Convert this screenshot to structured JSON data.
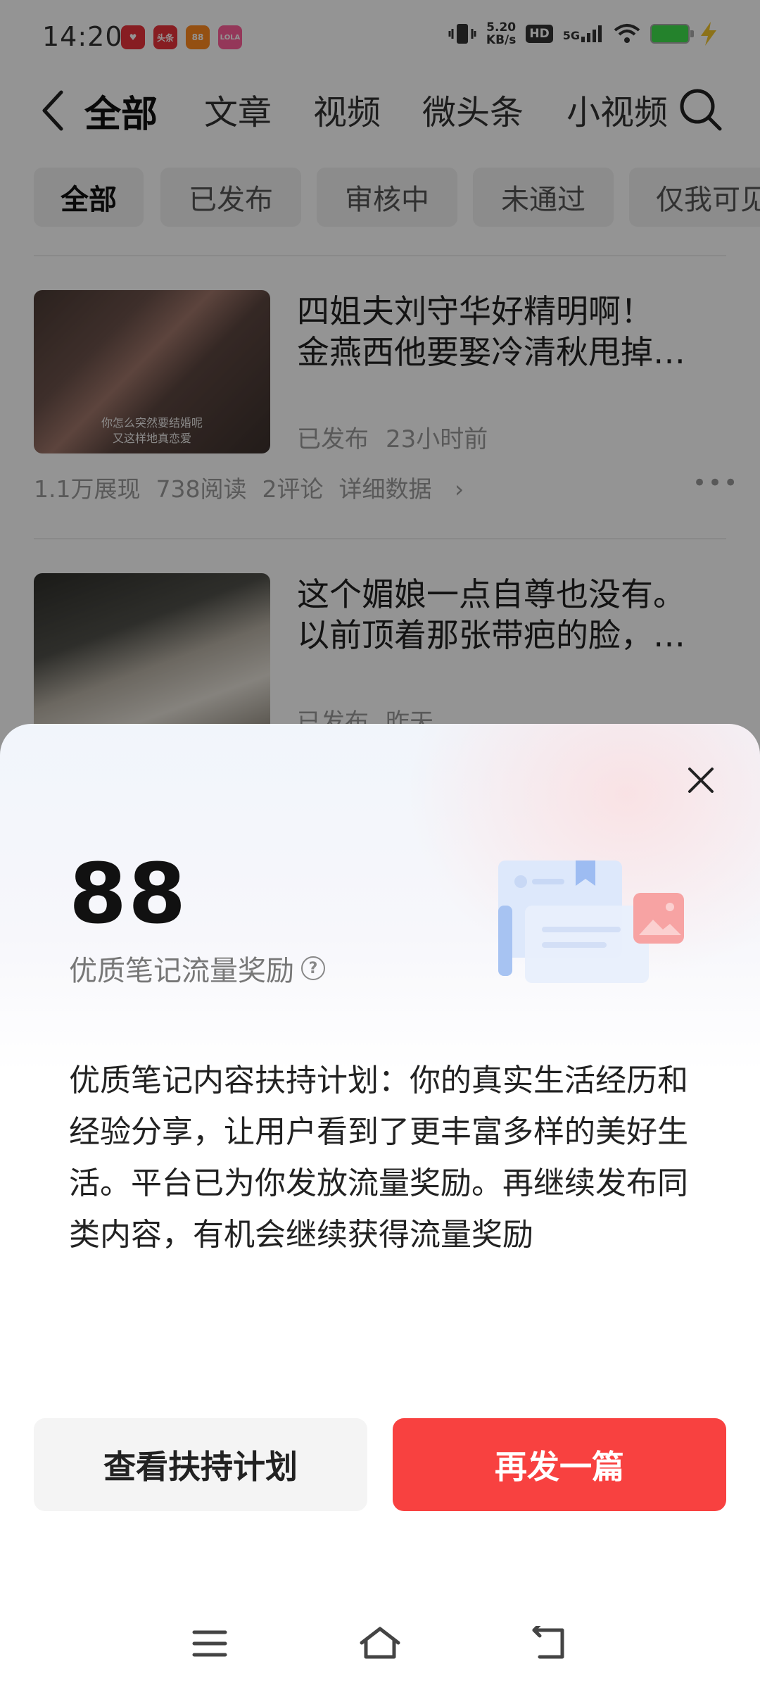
{
  "status_bar": {
    "time": "14:20",
    "app_icons": [
      {
        "icon": "heart-app-icon",
        "label": "",
        "color": "#e8323c"
      },
      {
        "icon": "toutiao-app-icon",
        "label": "头条",
        "color": "#e8323c"
      },
      {
        "icon": "orange-app-icon",
        "label": "88",
        "color": "#ff8a1f"
      },
      {
        "icon": "pink-app-icon",
        "label": "LOLA",
        "color": "#ff5f9a"
      }
    ],
    "net_speed_value": "5.20",
    "net_speed_unit": "KB/s",
    "hd": "HD",
    "signal": "5G"
  },
  "nav": {
    "tabs": [
      {
        "label": "全部",
        "active": true
      },
      {
        "label": "文章"
      },
      {
        "label": "视频"
      },
      {
        "label": "微头条"
      },
      {
        "label": "小视频"
      }
    ]
  },
  "filters": [
    {
      "label": "全部",
      "active": true
    },
    {
      "label": "已发布"
    },
    {
      "label": "审核中"
    },
    {
      "label": "未通过"
    },
    {
      "label": "仅我可见"
    }
  ],
  "feed": [
    {
      "title_line1": "四姐夫刘守华好精明啊！",
      "title_line2": "金燕西他要娶冷清秋甩掉…",
      "thumb_caption_1": "你怎么突然要结婚呢",
      "thumb_caption_2": "又这样地真恋爱",
      "status": "已发布",
      "time": "23小时前",
      "impressions": "1.1万展现",
      "reads": "738阅读",
      "comments": "2评论",
      "details_link": "详细数据"
    },
    {
      "title_line1": "这个媚娘一点自尊也没有。",
      "title_line2": "以前顶着那张带疤的脸，…",
      "status": "已发布",
      "time": "昨天"
    }
  ],
  "reward_sheet": {
    "count": "88",
    "label": "优质笔记流量奖励",
    "description": "优质笔记内容扶持计划：你的真实生活经历和经验分享，让用户看到了更丰富多样的美好生活。平台已为你发放流量奖励。再继续发布同类内容，有机会继续获得流量奖励",
    "secondary_button": "查看扶持计划",
    "primary_button": "再发一篇",
    "primary_color": "#f84140"
  },
  "system_nav": {
    "icons": [
      "menu-icon",
      "home-icon",
      "back-icon"
    ]
  }
}
